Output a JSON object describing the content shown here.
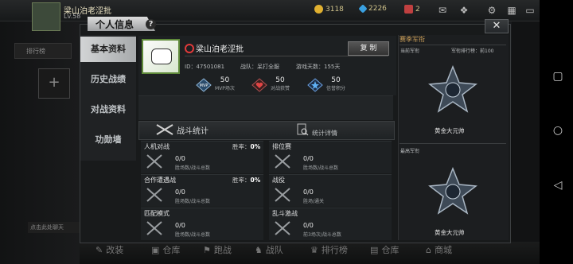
{
  "topbar": {
    "player_name": "梁山泊老涩批",
    "level": "Lv.58",
    "currencies": [
      {
        "icon": "gold-coin-icon",
        "value": "3118",
        "color": "#e0b030"
      },
      {
        "icon": "diamond-icon",
        "value": "2226",
        "color": "#3aa0e0"
      },
      {
        "icon": "ticket-icon",
        "value": "2",
        "color": "#c04040"
      }
    ]
  },
  "dialog": {
    "title": "个人信息",
    "help_label": "?",
    "close_label": "✕",
    "tabs": [
      "基本资料",
      "历史战绩",
      "对战资料",
      "功勋墙"
    ]
  },
  "profile": {
    "name": "梁山泊老涩批",
    "copy_label": "复 制",
    "id_text": "ID：47501081",
    "team_text": "战队：呆打全服",
    "days_text": "游戏天数：155天",
    "stats": [
      {
        "icon": "mvp-icon",
        "value": "50",
        "label": "MVP场次"
      },
      {
        "icon": "heart-icon",
        "value": "50",
        "label": "对战获赞"
      },
      {
        "icon": "star-badge-icon",
        "value": "50",
        "label": "信誉积分"
      }
    ]
  },
  "battle_stats": {
    "title": "战斗统计",
    "detail_label": "统计详情",
    "cards": [
      {
        "title": "人机对战",
        "rate_label": "胜率：",
        "rate": "0%",
        "value": "0/0",
        "sub": "胜场数/战斗总数"
      },
      {
        "title": "排位赛",
        "rate_label": "",
        "rate": "",
        "value": "0/0",
        "sub": "胜场数/战斗总数"
      },
      {
        "title": "合作遭遇战",
        "rate_label": "胜率：",
        "rate": "0%",
        "value": "0/0",
        "sub": "胜场数/战斗总数"
      },
      {
        "title": "战役",
        "rate_label": "",
        "rate": "",
        "value": "0/0",
        "sub": "胜场/通关"
      },
      {
        "title": "匹配模式",
        "rate_label": "",
        "rate": "",
        "value": "0/0",
        "sub": "胜场数/战斗总数"
      },
      {
        "title": "乱斗激战",
        "rate_label": "",
        "rate": "",
        "value": "0/0",
        "sub": "前3场次/战斗总数"
      }
    ]
  },
  "rank": {
    "heading": "赛季军衔",
    "current_label": "当前军衔",
    "ranking_label": "军衔排行榜：",
    "ranking_value": "前100",
    "current_rank": "黄金大元帅",
    "highest_label": "最高军衔",
    "highest_rank": "黄金大元帅"
  },
  "bottom_nav": [
    "改装",
    "仓库",
    "跑战",
    "战队",
    "排行榜",
    "仓库",
    "商城"
  ],
  "chat_text": "点击此处聊天",
  "side": {
    "ranked_label": "排行榜"
  },
  "android_nav": [
    "▢",
    "○",
    "◁"
  ]
}
